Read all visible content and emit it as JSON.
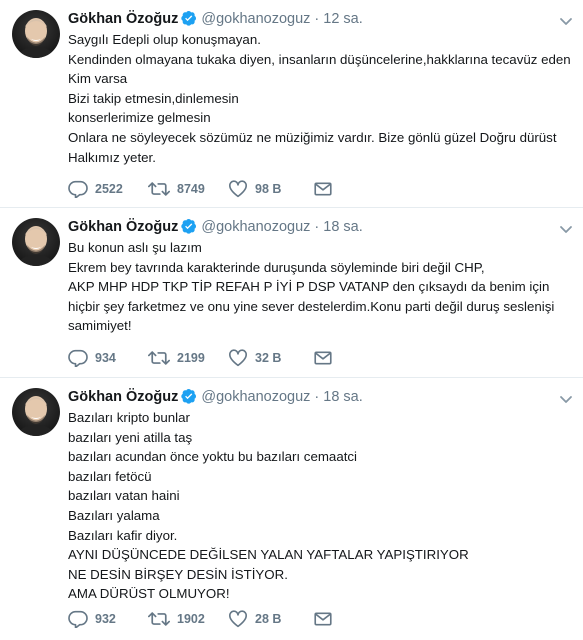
{
  "colors": {
    "accent": "#1da1f2",
    "muted": "#657786",
    "text": "#14171a",
    "divider": "#e6ecf0"
  },
  "tweets": [
    {
      "name": "Gökhan Özoğuz",
      "handle": "@gokhanozoguz",
      "time": "12 sa.",
      "lines": [
        "Saygılı Edepli olup konuşmayan.",
        "Kendinden olmayana tukaka diyen, insanların düşüncelerine,hakklarına tecavüz eden Kim varsa",
        "Bizi takip etmesin,dinlemesin",
        "konserlerimize gelmesin",
        "Onlara ne söyleyecek sözümüz ne müziğimiz vardır. Bize gönlü güzel Doğru dürüst Halkımız yeter."
      ],
      "replies": "2522",
      "retweets": "8749",
      "likes": "98 B"
    },
    {
      "name": "Gökhan Özoğuz",
      "handle": "@gokhanozoguz",
      "time": "18 sa.",
      "lines": [
        "Bu konun aslı şu  lazım",
        "Ekrem bey tavrında karakterinde duruşunda söyleminde biri değil CHP,",
        "AKP MHP HDP TKP TİP REFAH P İYİ P DSP VATANP den çıksaydı da benim için hiçbir şey farketmez ve onu yine sever destelerdim.Konu parti değil duruş seslenişi samimiyet!"
      ],
      "replies": "934",
      "retweets": "2199",
      "likes": "32 B"
    },
    {
      "name": "Gökhan Özoğuz",
      "handle": "@gokhanozoguz",
      "time": "18 sa.",
      "lines": [
        "Bazıları kripto bunlar",
        "bazıları yeni atilla taş",
        "bazıları acundan önce yoktu bu bazıları cemaatci",
        "bazıları fetöcü",
        "bazıları vatan haini",
        "Bazıları yalama",
        "Bazıları kafir diyor.",
        "AYNI DÜŞÜNCEDE DEĞİLSEN YALAN YAFTALAR YAPIŞTIRIYOR",
        "NE DESİN BİRŞEY DESİN İSTİYOR.",
        "AMA DÜRÜST OLMUYOR!"
      ],
      "replies": "932",
      "retweets": "1902",
      "likes": "28 B"
    }
  ]
}
